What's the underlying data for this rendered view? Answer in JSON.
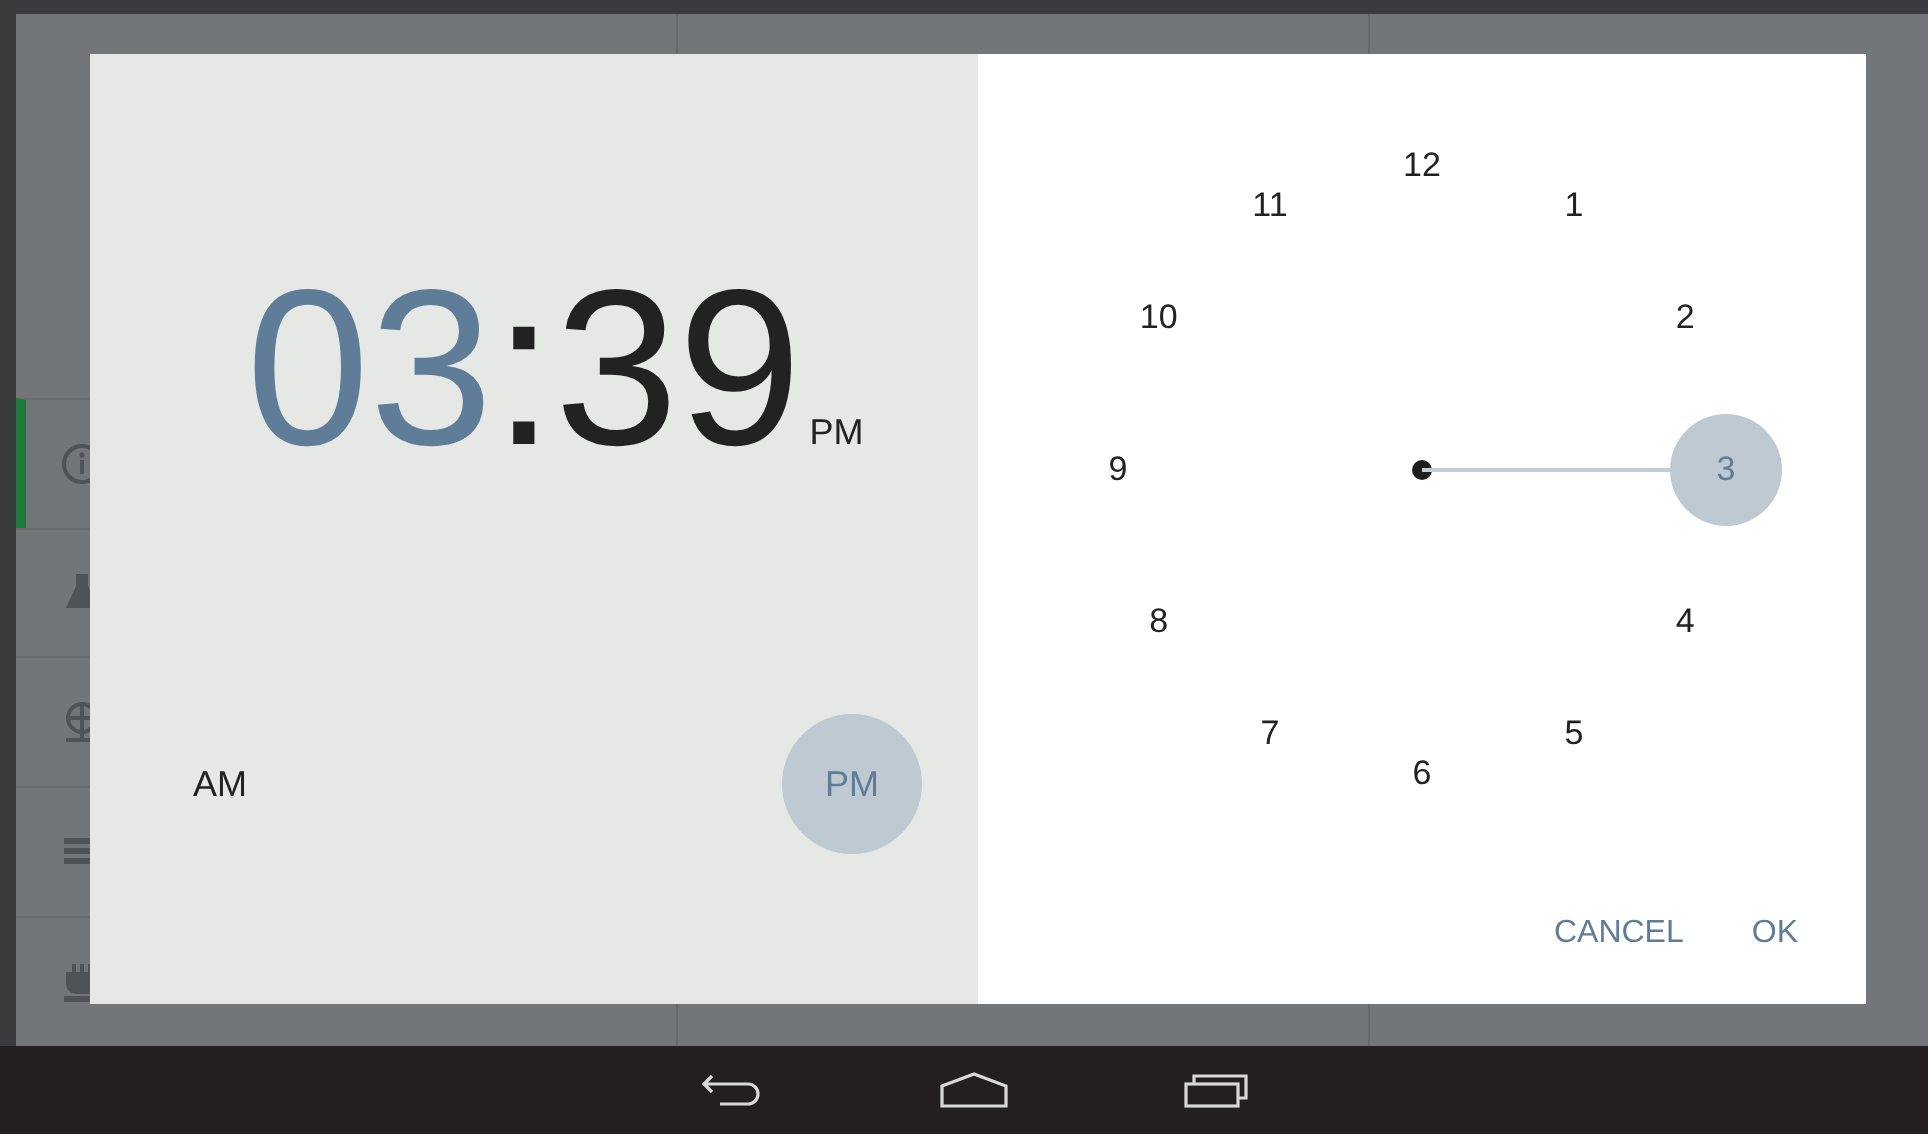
{
  "background": {
    "sidebar_items": [
      {
        "kind": "info",
        "selected": true
      },
      {
        "kind": "flask",
        "selected": false
      },
      {
        "kind": "globe",
        "selected": false
      },
      {
        "kind": "list",
        "selected": false
      },
      {
        "kind": "plug",
        "selected": false
      }
    ]
  },
  "time": {
    "hour": "03",
    "separator": ":",
    "minute": "39",
    "period": "PM",
    "hour_selected": true
  },
  "ampm": [
    {
      "label": "AM",
      "selected": false
    },
    {
      "label": "PM",
      "selected": true
    }
  ],
  "clock": {
    "numbers": [
      {
        "label": "12",
        "selected": false
      },
      {
        "label": "1",
        "selected": false
      },
      {
        "label": "2",
        "selected": false
      },
      {
        "label": "3",
        "selected": true
      },
      {
        "label": "4",
        "selected": false
      },
      {
        "label": "5",
        "selected": false
      },
      {
        "label": "6",
        "selected": false
      },
      {
        "label": "7",
        "selected": false
      },
      {
        "label": "8",
        "selected": false
      },
      {
        "label": "9",
        "selected": false
      },
      {
        "label": "10",
        "selected": false
      },
      {
        "label": "11",
        "selected": false
      }
    ]
  },
  "buttons": [
    {
      "label": "CANCEL"
    },
    {
      "label": "OK"
    }
  ]
}
